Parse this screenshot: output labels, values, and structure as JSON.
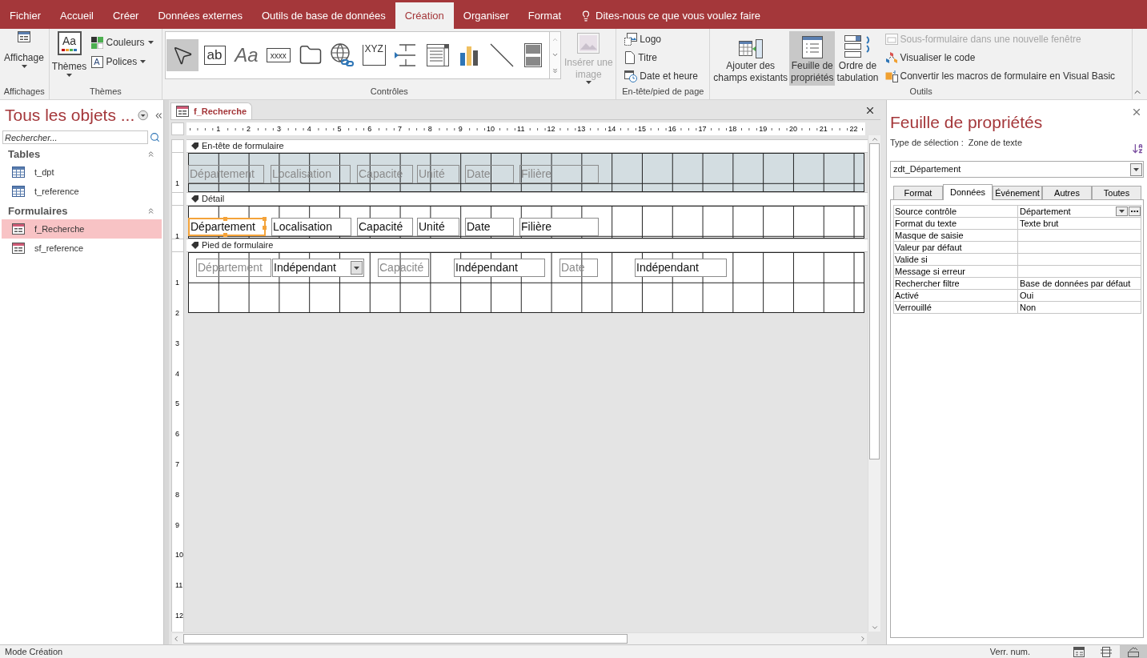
{
  "menu": {
    "tabs": [
      {
        "label": "Fichier",
        "selected": false
      },
      {
        "label": "Accueil",
        "selected": false
      },
      {
        "label": "Créer",
        "selected": false
      },
      {
        "label": "Données externes",
        "selected": false
      },
      {
        "label": "Outils de base de données",
        "selected": false
      },
      {
        "label": "Création",
        "selected": true
      },
      {
        "label": "Organiser",
        "selected": false
      },
      {
        "label": "Format",
        "selected": false
      }
    ],
    "tell_me": "Dites-nous ce que vous voulez faire"
  },
  "ribbon": {
    "views": {
      "button": "Affichage",
      "group": "Affichages"
    },
    "themes": {
      "themes": {
        "label": "Thèmes",
        "glyph": "Aa"
      },
      "colors": "Couleurs",
      "fonts": {
        "label": "Polices",
        "glyph": "A"
      },
      "group": "Thèmes"
    },
    "controls": {
      "tools": [
        {
          "kind": "pointer",
          "selected": true
        },
        {
          "kind": "textbox",
          "glyph": "ab",
          "selected": false
        },
        {
          "kind": "label",
          "glyph": "Aa",
          "selected": false
        },
        {
          "kind": "button",
          "glyph": "xxxx",
          "selected": false
        },
        {
          "kind": "tab",
          "selected": false
        },
        {
          "kind": "hyperlink",
          "selected": false
        },
        {
          "kind": "frame",
          "glyph": "XYZ",
          "selected": false
        },
        {
          "kind": "pagebreak",
          "selected": false
        },
        {
          "kind": "listbox",
          "selected": false
        },
        {
          "kind": "chart",
          "selected": false
        },
        {
          "kind": "line",
          "selected": false
        },
        {
          "kind": "toggle",
          "selected": false
        }
      ],
      "insert_image": {
        "lines": [
          "Insérer une",
          "image"
        ],
        "disabled": true
      },
      "group": "Contrôles"
    },
    "header_footer": {
      "items": [
        {
          "kind": "logo",
          "label": "Logo"
        },
        {
          "kind": "title",
          "label": "Titre"
        },
        {
          "kind": "datetime",
          "label": "Date et heure"
        }
      ],
      "group": "En-tête/pied de page"
    },
    "tools": {
      "large": [
        {
          "kind": "add_fields",
          "lines": [
            "Ajouter des",
            "champs existants"
          ],
          "selected": false
        },
        {
          "kind": "property_sheet",
          "lines": [
            "Feuille de",
            "propriétés"
          ],
          "selected": true
        },
        {
          "kind": "tab_order",
          "lines": [
            "Ordre de",
            "tabulation"
          ],
          "selected": false
        }
      ],
      "small": [
        {
          "kind": "subform",
          "label": "Sous-formulaire dans une nouvelle fenêtre",
          "disabled": true
        },
        {
          "kind": "code",
          "label": "Visualiser le code",
          "disabled": false
        },
        {
          "kind": "convert",
          "label": "Convertir les macros de formulaire en Visual Basic",
          "disabled": false
        }
      ],
      "group": "Outils"
    }
  },
  "navigation": {
    "title": "Tous les objets ...",
    "search_placeholder": "Rechercher...",
    "groups": [
      {
        "title": "Tables",
        "expanded": true,
        "items": [
          {
            "kind": "table",
            "label": "t_dpt",
            "selected": false
          },
          {
            "kind": "table",
            "label": "t_reference",
            "selected": false
          }
        ]
      },
      {
        "title": "Formulaires",
        "expanded": true,
        "items": [
          {
            "kind": "form",
            "label": "f_Recherche",
            "selected": true
          },
          {
            "kind": "form",
            "label": "sf_reference",
            "selected": false
          }
        ]
      }
    ]
  },
  "document": {
    "tab": "f_Recherche",
    "ruler": [
      "1",
      "2",
      "3",
      "4",
      "5",
      "6",
      "7",
      "8",
      "9",
      "10",
      "11",
      "12",
      "13",
      "14",
      "15",
      "16",
      "17",
      "18",
      "19",
      "20",
      "21",
      "22"
    ],
    "sections": [
      {
        "kind": "header",
        "title": "En-tête de formulaire",
        "ruler": [
          "1"
        ],
        "controls": [
          {
            "kind": "label",
            "text": "Département",
            "selected": false
          },
          {
            "kind": "label",
            "text": "Localisation",
            "selected": false
          },
          {
            "kind": "label",
            "text": "Capacité",
            "selected": false
          },
          {
            "kind": "label",
            "text": "Unité",
            "selected": false
          },
          {
            "kind": "label",
            "text": "Date",
            "selected": false
          },
          {
            "kind": "label",
            "text": "Filière",
            "selected": false
          }
        ]
      },
      {
        "kind": "detail",
        "title": "Détail",
        "ruler": [
          "1"
        ],
        "controls": [
          {
            "kind": "textbox",
            "text": "Département",
            "selected": true
          },
          {
            "kind": "textbox",
            "text": "Localisation",
            "selected": false
          },
          {
            "kind": "textbox",
            "text": "Capacité",
            "selected": false
          },
          {
            "kind": "textbox",
            "text": "Unité",
            "selected": false
          },
          {
            "kind": "textbox",
            "text": "Date",
            "selected": false
          },
          {
            "kind": "textbox",
            "text": "Filière",
            "selected": false
          }
        ]
      },
      {
        "kind": "footer",
        "title": "Pied de formulaire",
        "ruler": [
          "1",
          "2"
        ],
        "controls": [
          {
            "kind": "label",
            "text": "Département",
            "selected": false
          },
          {
            "kind": "combo",
            "text": "Indépendant",
            "selected": false
          },
          {
            "kind": "label",
            "text": "Capacité",
            "selected": false
          },
          {
            "kind": "textbox",
            "text": "Indépendant",
            "selected": false
          },
          {
            "kind": "label",
            "text": "Date",
            "selected": false
          },
          {
            "kind": "textbox",
            "text": "Indépendant",
            "selected": false
          }
        ]
      }
    ],
    "ruler_below": [
      "3",
      "4",
      "5",
      "6",
      "7",
      "8",
      "9",
      "10",
      "11",
      "12"
    ]
  },
  "property_sheet": {
    "title": "Feuille de propriétés",
    "selection_label": "Type de sélection :",
    "selection_type": "Zone de texte",
    "object": "zdt_Département",
    "tabs": [
      {
        "label": "Format",
        "selected": false
      },
      {
        "label": "Données",
        "selected": true
      },
      {
        "label": "Événement",
        "selected": false
      },
      {
        "label": "Autres",
        "selected": false
      },
      {
        "label": "Toutes",
        "selected": false
      }
    ],
    "rows": [
      {
        "kind": "combo",
        "name": "Source contrôle",
        "value": "Département"
      },
      {
        "kind": "text",
        "name": "Format du texte",
        "value": "Texte brut"
      },
      {
        "kind": "text",
        "name": "Masque de saisie"
      },
      {
        "kind": "text",
        "name": "Valeur par défaut"
      },
      {
        "kind": "text",
        "name": "Valide si"
      },
      {
        "kind": "text",
        "name": "Message si erreur"
      },
      {
        "kind": "text",
        "name": "Rechercher filtre",
        "value": "Base de données par défaut"
      },
      {
        "kind": "text",
        "name": "Activé",
        "value": "Oui"
      },
      {
        "kind": "text",
        "name": "Verrouillé",
        "value": "Non"
      }
    ]
  },
  "status_bar": {
    "mode": "Mode Création",
    "num_lock": "Verr. num.",
    "views": [
      {
        "kind": "form",
        "selected": false
      },
      {
        "kind": "layout",
        "selected": false
      },
      {
        "kind": "design",
        "selected": true
      }
    ]
  }
}
